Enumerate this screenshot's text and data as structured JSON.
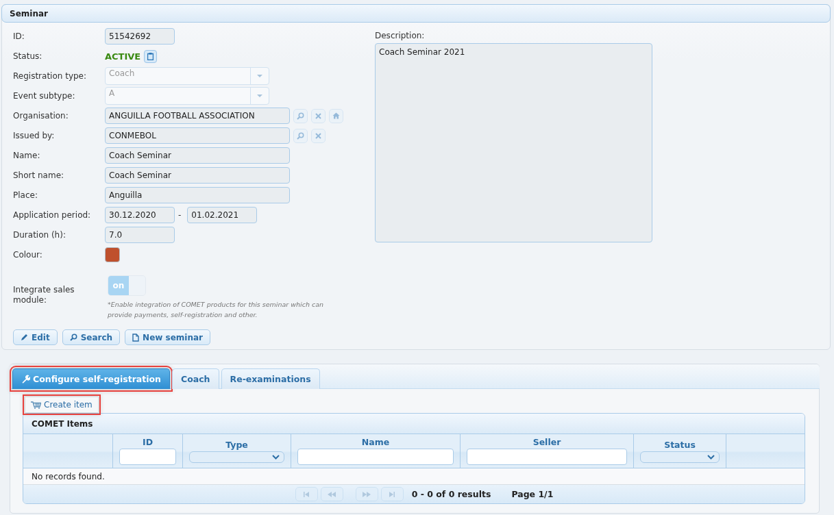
{
  "panel": {
    "title": "Seminar"
  },
  "fields": [
    {
      "label": "ID:",
      "kind": "short",
      "value": "51542692"
    },
    {
      "label": "Status:",
      "kind": "status",
      "value": "ACTIVE",
      "color": "#3a8a12"
    },
    {
      "label": "Registration type:",
      "kind": "select",
      "value": "Coach",
      "disabled": true
    },
    {
      "label": "Event subtype:",
      "kind": "select",
      "value": "A",
      "disabled": true
    },
    {
      "label": "Organisation:",
      "kind": "lookup",
      "value": "ANGUILLA FOOTBALL ASSOCIATION",
      "buttons": [
        {
          "kind": "search",
          "disabled": true
        },
        {
          "kind": "clear",
          "disabled": true
        },
        {
          "kind": "home",
          "disabled": true
        }
      ]
    },
    {
      "label": "Issued by:",
      "kind": "lookup",
      "value": "CONMEBOL",
      "buttons": [
        {
          "kind": "search",
          "disabled": true
        },
        {
          "kind": "clear",
          "disabled": true
        }
      ]
    },
    {
      "label": "Name:",
      "kind": "text",
      "value": "Coach Seminar"
    },
    {
      "label": "Short name:",
      "kind": "text",
      "value": "Coach Seminar"
    },
    {
      "label": "Place:",
      "kind": "text",
      "value": "Anguilla"
    },
    {
      "label": "Application period:",
      "kind": "range",
      "value": "30.12.2020",
      "separator": "-",
      "value_to": "01.02.2021"
    },
    {
      "label": "Duration (h):",
      "kind": "short",
      "value": "7.0"
    },
    {
      "label": "Colour:",
      "kind": "color",
      "color": "#bf502d"
    },
    {
      "label": "Integrate sales module:",
      "kind": "toggle",
      "on": true,
      "state_label": "on",
      "note": "*Enable integration of COMET products for this seminar which can provide payments, self-registration and other."
    }
  ],
  "description": {
    "label": "Description:",
    "value": "Coach Seminar 2021"
  },
  "actions": [
    {
      "kind": "edit",
      "label": "Edit"
    },
    {
      "kind": "search",
      "label": "Search"
    },
    {
      "kind": "new",
      "label": "New seminar"
    }
  ],
  "tabs": [
    {
      "kind": "wrench",
      "label": "Configure self-registration",
      "selected": true,
      "highlighted": true
    },
    {
      "kind": "plain",
      "label": "Coach",
      "selected": false,
      "highlighted": false
    },
    {
      "kind": "plain",
      "label": "Re-examinations",
      "selected": false,
      "highlighted": false
    }
  ],
  "create_button": {
    "label": "Create item",
    "highlighted": true
  },
  "table": {
    "title": "COMET Items",
    "columns": [
      {
        "kind": "blank"
      },
      {
        "label": "ID",
        "kind": "text"
      },
      {
        "label": "Type",
        "kind": "select"
      },
      {
        "label": "Name",
        "kind": "text"
      },
      {
        "label": "Seller",
        "kind": "text"
      },
      {
        "label": "Status",
        "kind": "select"
      },
      {
        "kind": "blank"
      }
    ],
    "empty_message": "No records found.",
    "pager": {
      "buttons": [
        {
          "kind": "first",
          "disabled": true
        },
        {
          "kind": "prev",
          "disabled": true
        },
        {
          "kind": "next",
          "disabled": true
        },
        {
          "kind": "last",
          "disabled": true
        }
      ],
      "results": "0 - 0 of 0 results",
      "page": "Page 1/1"
    }
  }
}
